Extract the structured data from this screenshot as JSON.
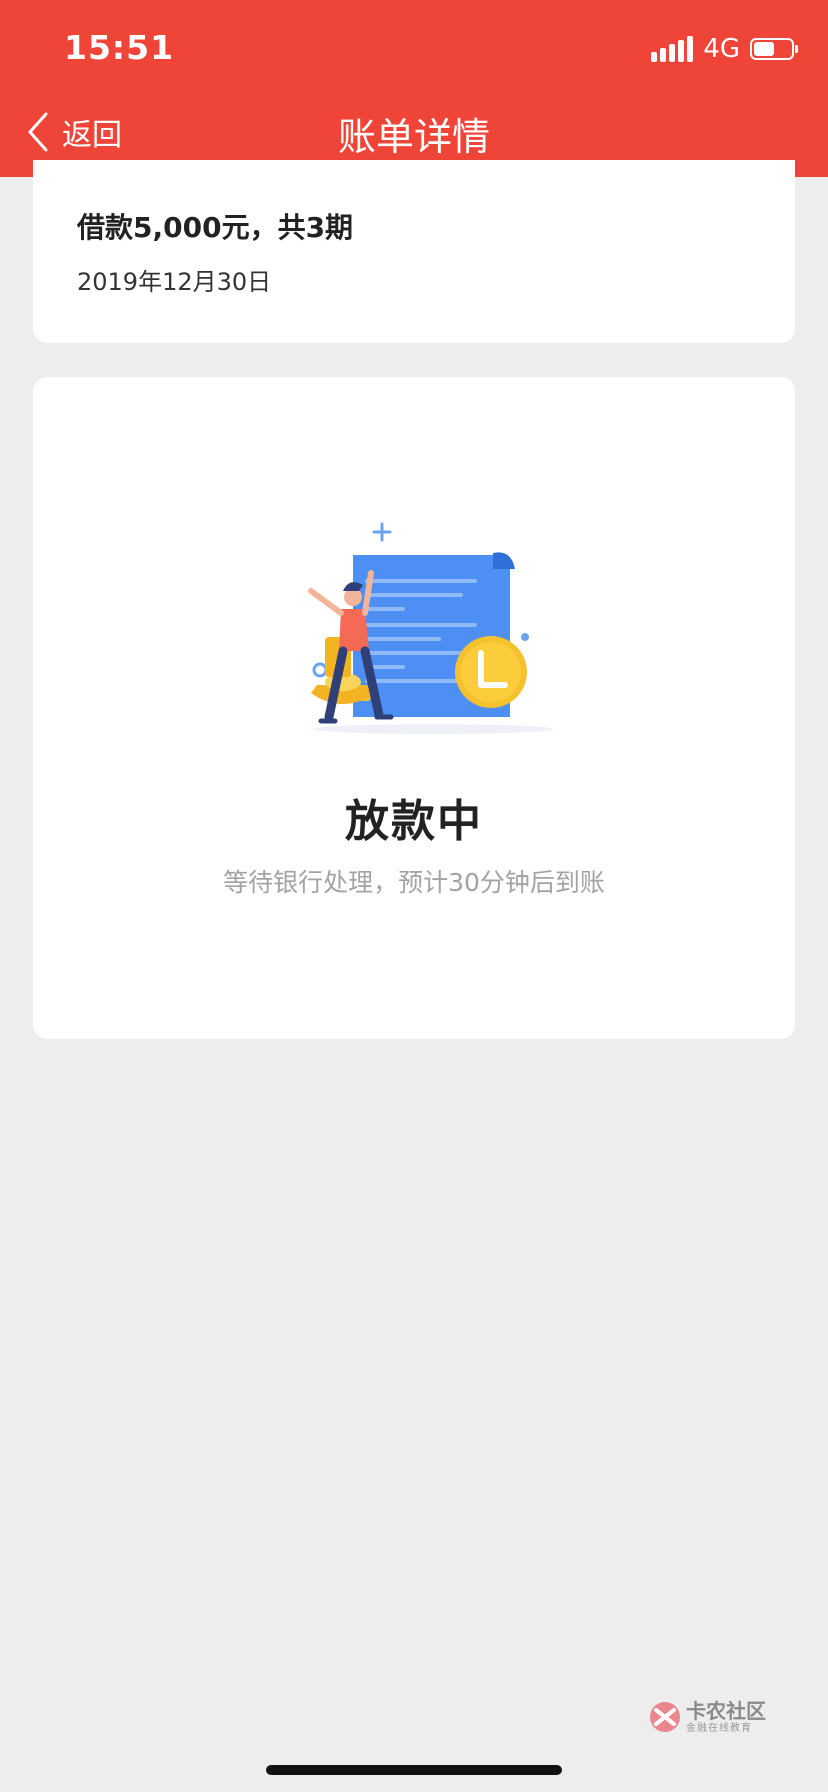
{
  "status_bar": {
    "time": "15:51",
    "network": "4G"
  },
  "nav": {
    "back_label": "返回",
    "title": "账单详情"
  },
  "loan": {
    "title": "借款5,000元，共3期",
    "date": "2019年12月30日"
  },
  "status": {
    "title": "放款中",
    "subtitle": "等待银行处理，预计30分钟后到账"
  },
  "watermark": {
    "name": "卡农社区",
    "tagline": "金融在线教育"
  },
  "colors": {
    "header": "#ef4438",
    "background": "#ededed",
    "card": "#ffffff"
  },
  "icons": {
    "back": "chevron-left-icon",
    "illustration": "loan-document-illustration"
  }
}
